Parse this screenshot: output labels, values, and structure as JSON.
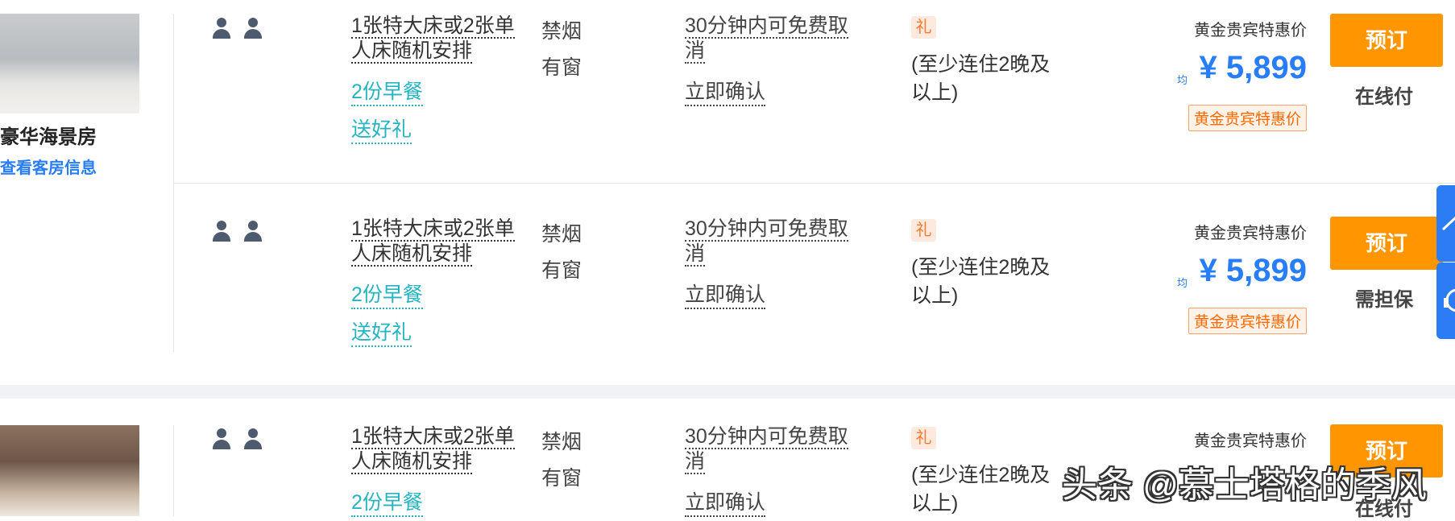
{
  "room": {
    "name": "豪华海景房",
    "info_link": "查看客房信息"
  },
  "offers": [
    {
      "bed": "1张特大床或2张单人床随机安排",
      "breakfast": "2份早餐",
      "gift": "送好礼",
      "smoking": "禁烟",
      "window": "有窗",
      "cancel": "30分钟内可免费取消",
      "confirm": "立即确认",
      "gift_badge": "礼",
      "min_stay": "(至少连住2晚及以上)",
      "vip_label": "黄金贵宾特惠价",
      "avg_label": "均",
      "price": "¥ 5,899",
      "vip_tag": "黄金贵宾特惠价",
      "book": "预订",
      "payment": "在线付"
    },
    {
      "bed": "1张特大床或2张单人床随机安排",
      "breakfast": "2份早餐",
      "gift": "送好礼",
      "smoking": "禁烟",
      "window": "有窗",
      "cancel": "30分钟内可免费取消",
      "confirm": "立即确认",
      "gift_badge": "礼",
      "min_stay": "(至少连住2晚及以上)",
      "vip_label": "黄金贵宾特惠价",
      "avg_label": "均",
      "price": "¥ 5,899",
      "vip_tag": "黄金贵宾特惠价",
      "book": "预订",
      "payment": "需担保"
    },
    {
      "bed": "1张特大床或2张单人床随机安排",
      "breakfast": "2份早餐",
      "smoking": "禁烟",
      "window": "有窗",
      "cancel": "30分钟内可免费取消",
      "confirm": "立即确认",
      "gift_badge": "礼",
      "min_stay": "(至少连住2晚及以上)",
      "vip_label": "黄金贵宾特惠价",
      "book": "预订",
      "payment": "在线付"
    }
  ],
  "watermark": "头条 @慕士塔格的季风",
  "colors": {
    "accent": "#287dfa",
    "book": "#ff9500",
    "link": "#25b4c0",
    "gift": "#ff7a2e"
  },
  "icons": [
    "guest-icon",
    "back-to-top-icon",
    "customer-service-icon"
  ]
}
